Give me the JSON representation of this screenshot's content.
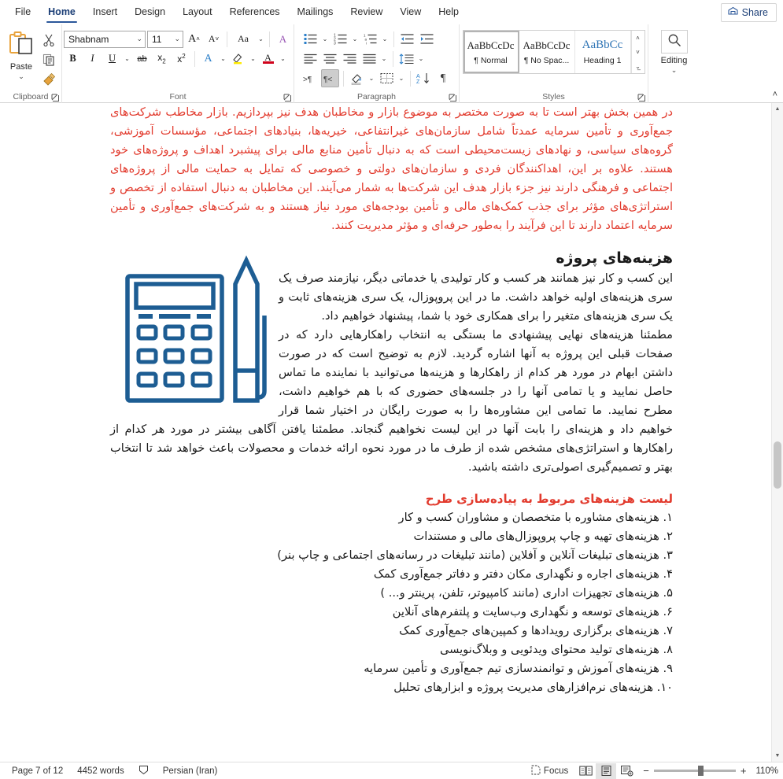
{
  "ribbon": {
    "tabs": [
      {
        "label": "File",
        "active": false
      },
      {
        "label": "Home",
        "active": true
      },
      {
        "label": "Insert",
        "active": false
      },
      {
        "label": "Design",
        "active": false
      },
      {
        "label": "Layout",
        "active": false
      },
      {
        "label": "References",
        "active": false
      },
      {
        "label": "Mailings",
        "active": false
      },
      {
        "label": "Review",
        "active": false
      },
      {
        "label": "View",
        "active": false
      },
      {
        "label": "Help",
        "active": false
      }
    ],
    "share_label": "Share",
    "groups": {
      "clipboard": {
        "label": "Clipboard",
        "paste_label": "Paste",
        "cut_name": "cut",
        "copy_name": "copy",
        "format_painter_name": "format-painter"
      },
      "font": {
        "label": "Font",
        "font_name": "Shabnam",
        "font_size": "11",
        "grow_font": "A",
        "shrink_font": "A",
        "change_case": "Aa",
        "clear_formatting": "A",
        "bold": "B",
        "italic": "I",
        "underline": "U",
        "strikethrough": "ab",
        "subscript": "x",
        "superscript": "x",
        "text_effects": "A",
        "highlight": "A",
        "font_color": "A"
      },
      "paragraph": {
        "label": "Paragraph",
        "bullets": "bullets",
        "numbering": "numbering",
        "multilevel": "multilevel-list",
        "decrease_indent": "decrease-indent",
        "increase_indent": "increase-indent",
        "align_left": "align-left",
        "align_center": "align-center",
        "align_right": "align-right",
        "justify": "justify",
        "line_spacing": "line-spacing",
        "ltr_text": "ltr-direction",
        "rtl_text": "rtl-direction",
        "shading": "shading",
        "borders": "borders",
        "sort": "sort",
        "show_marks": "show-formatting-marks",
        "rtl_active": true
      },
      "styles": {
        "label": "Styles",
        "items": [
          {
            "preview": "AaBbCcDc",
            "name": "¶ Normal",
            "selected": true
          },
          {
            "preview": "AaBbCcDc",
            "name": "¶ No Spac...",
            "selected": false
          },
          {
            "preview": "AaBbCc",
            "name": "Heading 1",
            "selected": false
          }
        ]
      },
      "editing": {
        "label": "Editing",
        "button_label": "Editing"
      }
    }
  },
  "document": {
    "paragraph_red_1": "در همین بخش بهتر است تا به صورت مختصر به موضوع بازار و مخاطبان هدف نیز بپردازیم. بازار مخاطب شرکت‌های جمع‌آوری و تأمین سرمایه عمدتاً شامل سازمان‌های غیرانتفاعی، خیریه‌ها، بنیادهای اجتماعی، مؤسسات آموزشی، گروه‌های سیاسی، و نهادهای زیست‌محیطی است که به دنبال تأمین منابع مالی برای پیشبرد اهداف و پروژه‌های خود هستند. علاوه بر این، اهداکنندگان فردی و سازمان‌های دولتی و خصوصی که تمایل به حمایت مالی از پروژه‌های اجتماعی و فرهنگی دارند نیز جزء بازار هدف این شرکت‌ها به شمار می‌آیند. این مخاطبان به دنبال استفاده از تخصص و استراتژی‌های مؤثر برای جذب کمک‌های مالی و تأمین بودجه‌های مورد نیاز هستند و به شرکت‌های جمع‌آوری و تأمین سرمایه اعتماد دارند تا این فرآیند را به‌طور حرفه‌ای و مؤثر مدیریت کنند.",
    "heading": "هزینه‌های پروژه",
    "paragraph_2": "این کسب و کار نیز همانند هر کسب و کار تولیدی یا خدماتی دیگر، نیازمند صرف یک سری هزینه‌های اولیه خواهد داشت. ما در این پروپوزال، یک سری هزینه‌های ثابت و یک سری هزینه‌های متغیر را برای همکاری خود با شما، پیشنهاد خواهیم داد.",
    "paragraph_3": "مطمئنا هزینه‌های نهایی پیشنهادی ما بستگی به انتخاب راهکارهایی دارد که در صفحات قبلی این پروژه به آنها اشاره گردید. لازم به توضیح است که در صورت داشتن ابهام در مورد هر کدام از راهکارها و هزینه‌ها می‌توانید با نماینده ما تماس حاصل نمایید و یا تمامی آنها را در جلسه‌های حضوری که با هم خواهیم داشت، مطرح نمایید. ما تمامی این مشاوره‌ها را به صورت رایگان در اختیار شما قرار خواهیم داد و هزینه‌ای را بابت آنها در این لیست نخواهیم گنجاند. مطمئنا یافتن آگاهی بیشتر در مورد هر کدام از راهکارها و استراتژی‌های مشخص شده از طرف ما در مورد نحوه ارائه خدمات و محصولات باعث خواهد شد تا انتخاب بهتر و تصمیم‌گیری اصولی‌تری داشته باشید.",
    "subheading_red": "لیست هزینه‌های مربوط به پیاده‌سازی طرح",
    "list_items": [
      "۱. هزینه‌های مشاوره با متخصصان و مشاوران کسب و کار",
      "۲. هزینه‌های تهیه و چاپ پروپوزال‌های مالی و مستندات",
      "۳. هزینه‌های تبلیغات آنلاین و آفلاین (مانند تبلیغات در رسانه‌های اجتماعی و چاپ بنر)",
      "۴. هزینه‌های اجاره و نگهداری مکان دفتر و دفاتر جمع‌آوری کمک",
      "۵. هزینه‌های تجهیزات اداری (مانند کامپیوتر، تلفن، پرینتر و... )",
      "۶. هزینه‌های توسعه و نگهداری وب‌سایت و پلتفرم‌های آنلاین",
      "۷. هزینه‌های برگزاری رویدادها و کمپین‌های جمع‌آوری کمک",
      "۸. هزینه‌های تولید محتوای ویدئویی و وبلاگ‌نویسی",
      "۹. هزینه‌های آموزش و توانمندسازی تیم جمع‌آوری و تأمین سرمایه",
      "۱۰. هزینه‌های نرم‌افزارهای مدیریت پروژه و ابزارهای تحلیل"
    ],
    "figure_name": "calculator-and-pencil-illustration",
    "figure_color": "#1d5d93"
  },
  "status_bar": {
    "page_info": "Page 7 of 12",
    "word_count": "4452 words",
    "proofing_name": "proofing-icon",
    "language": "Persian (Iran)",
    "focus_label": "Focus",
    "views": [
      {
        "name": "read-mode",
        "selected": false
      },
      {
        "name": "print-layout",
        "selected": true
      },
      {
        "name": "web-layout",
        "selected": false
      }
    ],
    "zoom_out": "−",
    "zoom_in": "+",
    "zoom_level": "110%"
  },
  "colors": {
    "accent": "#2b579a",
    "red_text": "#e23b2e",
    "heading_blue": "#2e74b5",
    "figure_blue": "#1d5d93"
  }
}
